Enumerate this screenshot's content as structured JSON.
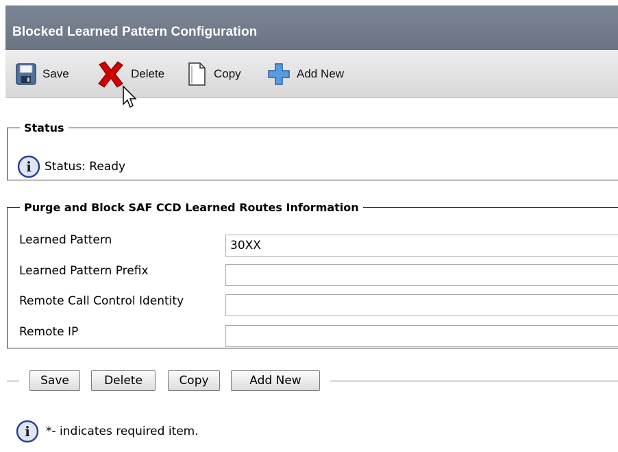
{
  "title": "Blocked Learned Pattern Configuration",
  "toolbar": {
    "save_label": "Save",
    "delete_label": "Delete",
    "copy_label": "Copy",
    "add_new_label": "Add New"
  },
  "status_section": {
    "legend": "Status",
    "status_text": "Status: Ready"
  },
  "purge_section": {
    "legend": "Purge and Block SAF CCD Learned Routes Information",
    "fields": [
      {
        "label": "Learned Pattern",
        "value": "30XX"
      },
      {
        "label": "Learned Pattern Prefix",
        "value": ""
      },
      {
        "label": "Remote Call Control Identity",
        "value": ""
      },
      {
        "label": "Remote IP",
        "value": ""
      }
    ]
  },
  "bottom_buttons": {
    "save": "Save",
    "delete": "Delete",
    "copy": "Copy",
    "add_new": "Add New"
  },
  "footer": {
    "note": "*- indicates required item."
  },
  "colors": {
    "title_bar": "#6a7482",
    "toolbar": "#e3e3e3",
    "delete_icon": "#cc0000",
    "add_icon": "#3a7fd0",
    "info_icon": "#2b3f8f"
  }
}
